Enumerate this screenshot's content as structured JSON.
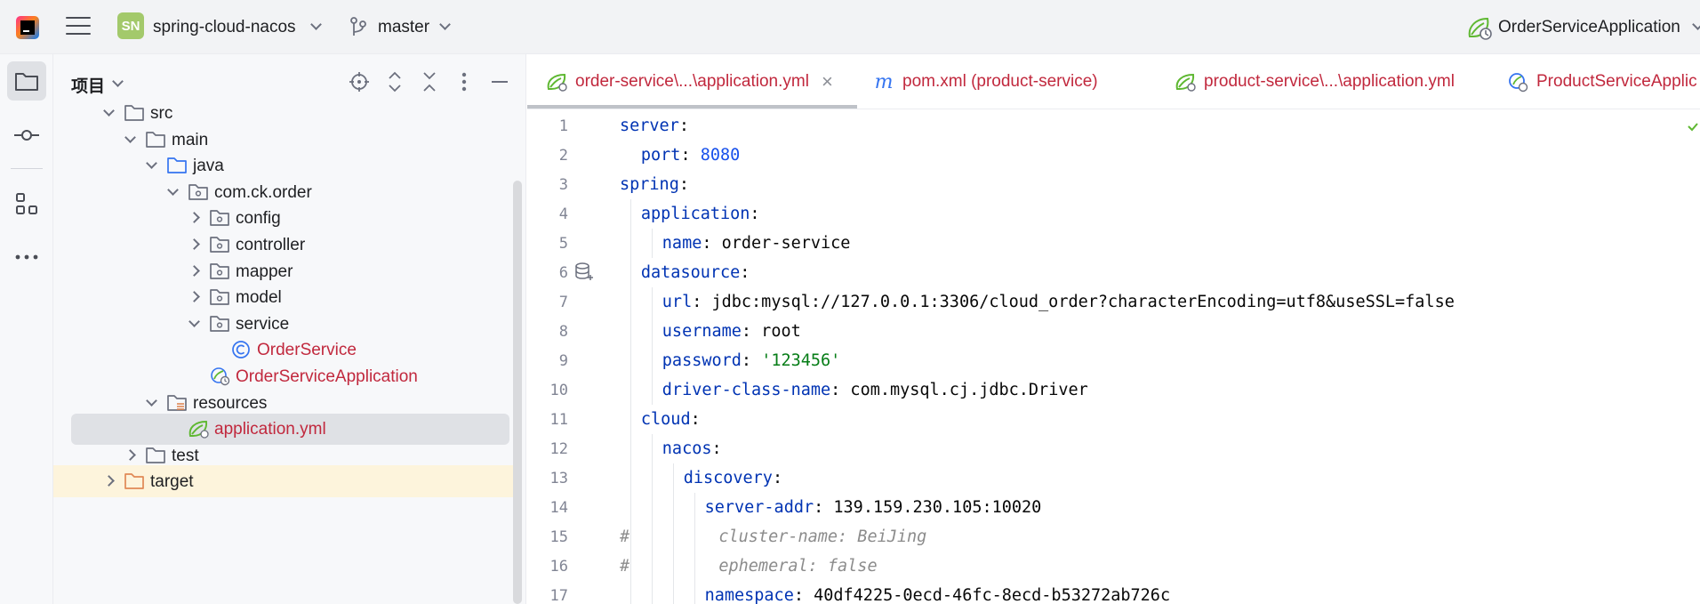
{
  "titlebar": {
    "project_chip": "SN",
    "project_name": "spring-cloud-nacos",
    "branch": "master",
    "run_config": "OrderServiceApplication"
  },
  "toolstrip": {
    "items": [
      "project-folder-icon",
      "commit-icon",
      "structure-icon",
      "more-icon"
    ]
  },
  "project_panel": {
    "title": "项目",
    "tree": [
      {
        "label": "src",
        "depth": 0,
        "state": "open",
        "kind": "folder"
      },
      {
        "label": "main",
        "depth": 1,
        "state": "open",
        "kind": "folder"
      },
      {
        "label": "java",
        "depth": 2,
        "state": "open",
        "kind": "source-folder"
      },
      {
        "label": "com.ck.order",
        "depth": 3,
        "state": "open",
        "kind": "package"
      },
      {
        "label": "config",
        "depth": 4,
        "state": "closed",
        "kind": "package"
      },
      {
        "label": "controller",
        "depth": 4,
        "state": "closed",
        "kind": "package"
      },
      {
        "label": "mapper",
        "depth": 4,
        "state": "closed",
        "kind": "package"
      },
      {
        "label": "model",
        "depth": 4,
        "state": "closed",
        "kind": "package"
      },
      {
        "label": "service",
        "depth": 4,
        "state": "open",
        "kind": "package"
      },
      {
        "label": "OrderService",
        "depth": 5,
        "state": "none",
        "kind": "class"
      },
      {
        "label": "OrderServiceApplication",
        "depth": 4,
        "state": "none",
        "kind": "spring-app"
      },
      {
        "label": "resources",
        "depth": 2,
        "state": "open",
        "kind": "resources-folder"
      },
      {
        "label": "application.yml",
        "depth": 3,
        "state": "none",
        "kind": "spring-yml"
      },
      {
        "label": "test",
        "depth": 1,
        "state": "closed",
        "kind": "folder"
      },
      {
        "label": "target",
        "depth": 0,
        "state": "closed",
        "kind": "excluded-folder"
      }
    ]
  },
  "editor": {
    "tabs": [
      {
        "label": "order-service\\...\\application.yml",
        "icon": "spring-yml-icon",
        "active": true
      },
      {
        "label": "pom.xml (product-service)",
        "icon": "maven-icon",
        "active": false
      },
      {
        "label": "product-service\\...\\application.yml",
        "icon": "spring-yml-icon",
        "active": false
      },
      {
        "label": "ProductServiceApplic",
        "icon": "spring-app-icon",
        "active": false
      }
    ],
    "lines": [
      {
        "n": "1",
        "indent": 0,
        "parts": [
          [
            "k",
            "server"
          ],
          [
            "p",
            ":"
          ]
        ]
      },
      {
        "n": "2",
        "indent": 1,
        "parts": [
          [
            "k",
            "port"
          ],
          [
            "p",
            ": "
          ],
          [
            "n",
            "8080"
          ]
        ]
      },
      {
        "n": "3",
        "indent": 0,
        "parts": [
          [
            "k",
            "spring"
          ],
          [
            "p",
            ":"
          ]
        ]
      },
      {
        "n": "4",
        "indent": 1,
        "parts": [
          [
            "k",
            "application"
          ],
          [
            "p",
            ":"
          ]
        ]
      },
      {
        "n": "5",
        "indent": 2,
        "parts": [
          [
            "k",
            "name"
          ],
          [
            "p",
            ": order-service"
          ]
        ]
      },
      {
        "n": "6",
        "indent": 1,
        "parts": [
          [
            "k",
            "datasource"
          ],
          [
            "p",
            ":"
          ]
        ]
      },
      {
        "n": "7",
        "indent": 2,
        "parts": [
          [
            "k",
            "url"
          ],
          [
            "p",
            ": jdbc:mysql://127.0.0.1:3306/cloud_order?characterEncoding=utf8&useSSL=false"
          ]
        ]
      },
      {
        "n": "8",
        "indent": 2,
        "parts": [
          [
            "k",
            "username"
          ],
          [
            "p",
            ": root"
          ]
        ]
      },
      {
        "n": "9",
        "indent": 2,
        "parts": [
          [
            "k",
            "password"
          ],
          [
            "p",
            ": "
          ],
          [
            "v",
            "'123456'"
          ]
        ]
      },
      {
        "n": "10",
        "indent": 2,
        "parts": [
          [
            "k",
            "driver-class-name"
          ],
          [
            "p",
            ": com.mysql.cj.jdbc.Driver"
          ]
        ]
      },
      {
        "n": "11",
        "indent": 1,
        "parts": [
          [
            "k",
            "cloud"
          ],
          [
            "p",
            ":"
          ]
        ]
      },
      {
        "n": "12",
        "indent": 2,
        "parts": [
          [
            "k",
            "nacos"
          ],
          [
            "p",
            ":"
          ]
        ]
      },
      {
        "n": "13",
        "indent": 3,
        "parts": [
          [
            "k",
            "discovery"
          ],
          [
            "p",
            ":"
          ]
        ]
      },
      {
        "n": "14",
        "indent": 4,
        "parts": [
          [
            "k",
            "server-addr"
          ],
          [
            "p",
            ": 139.159.230.105:10020"
          ]
        ]
      },
      {
        "n": "15",
        "indent": 0,
        "parts": [
          [
            "c",
            "#         cluster-name: BeiJing"
          ]
        ]
      },
      {
        "n": "16",
        "indent": 0,
        "parts": [
          [
            "c",
            "#         ephemeral: false"
          ]
        ]
      },
      {
        "n": "17",
        "indent": 4,
        "parts": [
          [
            "k",
            "namespace"
          ],
          [
            "p",
            ": 40df4225-0ecd-46fc-8ecd-b53272ab726c"
          ]
        ]
      }
    ]
  },
  "colors": {
    "error_red": "#c1283d",
    "yaml_key": "#0033b3",
    "yaml_string": "#067d17",
    "yaml_number": "#1750eb",
    "selection": "#dfe1e5",
    "excluded": "#fdf4dc"
  }
}
